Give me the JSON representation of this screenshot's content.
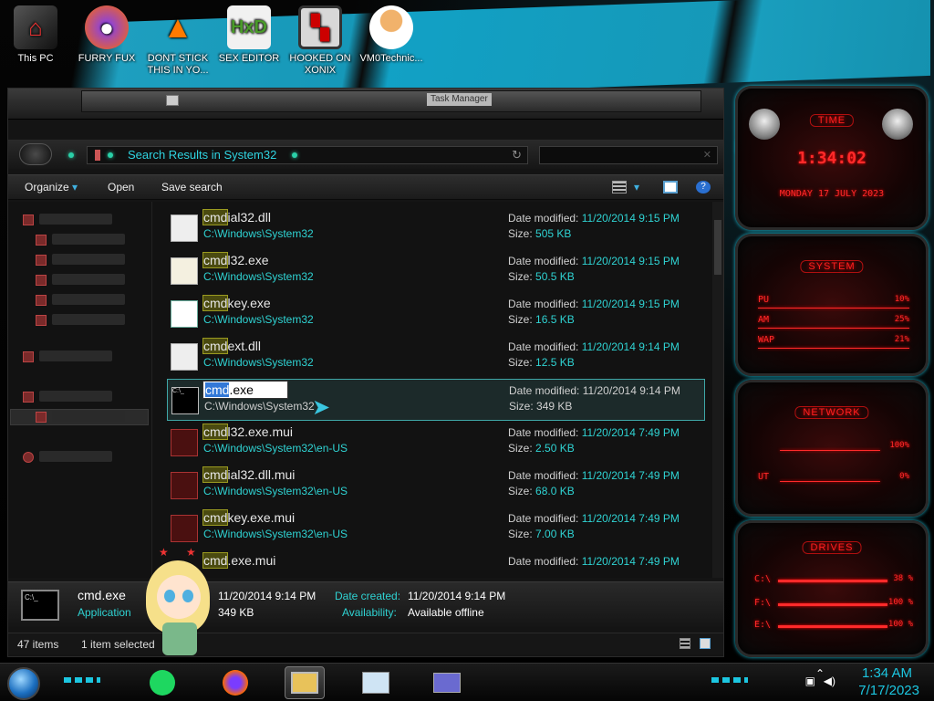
{
  "desktop": {
    "icons": [
      {
        "label": "This PC"
      },
      {
        "label": "FURRY FUX"
      },
      {
        "label": "DONT STICK THIS IN YO..."
      },
      {
        "label": "SEX EDITOR"
      },
      {
        "label": "HOOKED ON XONIX"
      },
      {
        "label": "VM0Technic..."
      }
    ]
  },
  "window": {
    "inner_title": "Task Manager",
    "address": "Search Results in System32",
    "search_placeholder": "",
    "toolbar": {
      "organize": "Organize",
      "open": "Open",
      "save_search": "Save search"
    }
  },
  "files": [
    {
      "hl": "cmd",
      "rest": "ial32.dll",
      "path": "C:\\Windows\\System32",
      "modified_label": "Date modified:",
      "modified": "11/20/2014 9:15 PM",
      "size_label": "Size:",
      "size": "505 KB"
    },
    {
      "hl": "cmd",
      "rest": "l32.exe",
      "path": "C:\\Windows\\System32",
      "modified_label": "Date modified:",
      "modified": "11/20/2014 9:15 PM",
      "size_label": "Size:",
      "size": "50.5 KB"
    },
    {
      "hl": "cmd",
      "rest": "key.exe",
      "path": "C:\\Windows\\System32",
      "modified_label": "Date modified:",
      "modified": "11/20/2014 9:15 PM",
      "size_label": "Size:",
      "size": "16.5 KB"
    },
    {
      "hl": "cmd",
      "rest": "ext.dll",
      "path": "C:\\Windows\\System32",
      "modified_label": "Date modified:",
      "modified": "11/20/2014 9:14 PM",
      "size_label": "Size:",
      "size": "12.5 KB"
    },
    {
      "hl": "cmd",
      "rest": ".exe",
      "path": "C:\\Windows\\System32",
      "modified_label": "Date modified:",
      "modified": "11/20/2014 9:14 PM",
      "size_label": "Size:",
      "size": "349 KB",
      "selected": true
    },
    {
      "hl": "cmd",
      "rest": "l32.exe.mui",
      "path": "C:\\Windows\\System32\\en-US",
      "modified_label": "Date modified:",
      "modified": "11/20/2014 7:49 PM",
      "size_label": "Size:",
      "size": "2.50 KB"
    },
    {
      "hl": "cmd",
      "rest": "ial32.dll.mui",
      "path": "C:\\Windows\\System32\\en-US",
      "modified_label": "Date modified:",
      "modified": "11/20/2014 7:49 PM",
      "size_label": "Size:",
      "size": "68.0 KB"
    },
    {
      "hl": "cmd",
      "rest": "key.exe.mui",
      "path": "C:\\Windows\\System32\\en-US",
      "modified_label": "Date modified:",
      "modified": "11/20/2014 7:49 PM",
      "size_label": "Size:",
      "size": "7.00 KB"
    },
    {
      "hl": "cmd",
      "rest": ".exe.mui",
      "path": "",
      "modified_label": "Date modified:",
      "modified": "11/20/2014 7:49 PM",
      "size_label": "",
      "size": ""
    }
  ],
  "rename": {
    "selected": "cmd",
    "rest": ".exe"
  },
  "details": {
    "name": "cmd.exe",
    "type": "Application",
    "date_modified": "11/20/2014 9:14 PM",
    "size": "349 KB",
    "created_label": "Date created:",
    "created": "11/20/2014 9:14 PM",
    "availability_label": "Availability:",
    "availability": "Available offline"
  },
  "status": {
    "items": "47 items",
    "selected": "1 item selected"
  },
  "gadgets": {
    "time": {
      "title": "TIME",
      "clock": "1:34:02",
      "date": "MONDAY 17 JULY 2023"
    },
    "system": {
      "title": "SYSTEM",
      "rows": [
        {
          "label": "PU",
          "value": "10%"
        },
        {
          "label": "AM",
          "value": "25%"
        },
        {
          "label": "WAP",
          "value": "21%"
        }
      ]
    },
    "network": {
      "title": "NETWORK",
      "rows": [
        {
          "label": "",
          "value": "100%"
        },
        {
          "label": "UT",
          "value": "0%"
        }
      ]
    },
    "drives": {
      "title": "DRIVES",
      "rows": [
        {
          "label": "C:\\",
          "value": "38 %"
        },
        {
          "label": "F:\\",
          "value": "100 %"
        },
        {
          "label": "E:\\",
          "value": "100 %"
        }
      ]
    }
  },
  "taskbar": {
    "time": "1:34 AM",
    "date": "7/17/2023"
  },
  "colors": {
    "accent_cyan": "#2fd3d3",
    "gadget_red": "#ff2a2a",
    "highlight": "#4a4a10"
  }
}
